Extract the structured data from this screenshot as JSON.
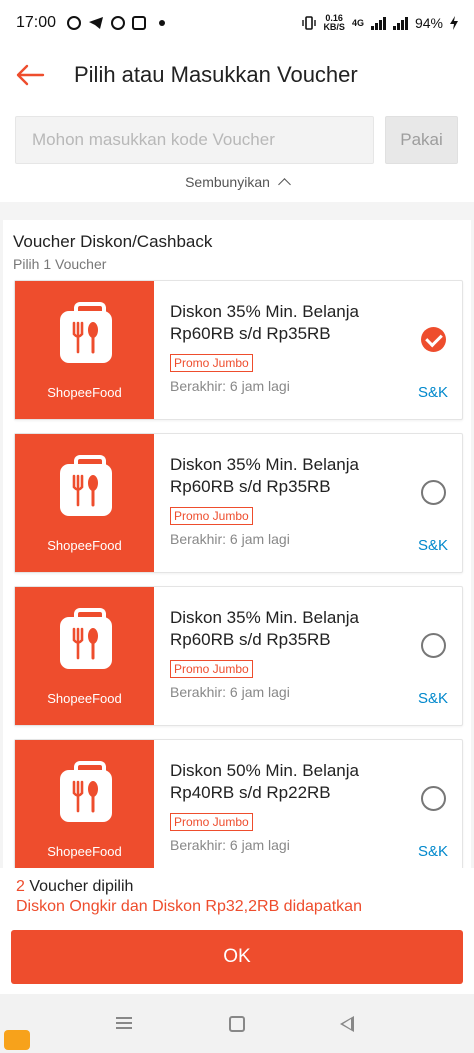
{
  "status_bar": {
    "time": "17:00",
    "net_speed_value": "0.16",
    "net_speed_unit": "KB/S",
    "network": "4G",
    "battery": "94%"
  },
  "header": {
    "title": "Pilih atau Masukkan Voucher"
  },
  "code_entry": {
    "placeholder": "Mohon masukkan kode Voucher",
    "apply_label": "Pakai"
  },
  "collapse": {
    "label": "Sembunyikan"
  },
  "section": {
    "title": "Voucher Diskon/Cashback",
    "subtitle": "Pilih 1 Voucher",
    "vouchers": [
      {
        "brand": "ShopeeFood",
        "title_line1": "Diskon 35% Min. Belanja",
        "title_line2": "Rp60RB s/d Rp35RB",
        "tag": "Promo Jumbo",
        "expiry": "Berakhir: 6 jam lagi",
        "terms": "S&K",
        "selected": true
      },
      {
        "brand": "ShopeeFood",
        "title_line1": "Diskon 35% Min. Belanja",
        "title_line2": "Rp60RB s/d Rp35RB",
        "tag": "Promo Jumbo",
        "expiry": "Berakhir: 6 jam lagi",
        "terms": "S&K",
        "selected": false
      },
      {
        "brand": "ShopeeFood",
        "title_line1": "Diskon 35% Min. Belanja",
        "title_line2": "Rp60RB s/d Rp35RB",
        "tag": "Promo Jumbo",
        "expiry": "Berakhir: 6 jam lagi",
        "terms": "S&K",
        "selected": false
      },
      {
        "brand": "ShopeeFood",
        "title_line1": "Diskon 50% Min. Belanja",
        "title_line2": "Rp40RB s/d Rp22RB",
        "tag": "Promo Jumbo",
        "expiry": "Berakhir: 6 jam lagi",
        "terms": "S&K",
        "selected": false
      }
    ]
  },
  "summary": {
    "count": "2",
    "count_label": " Voucher dipilih",
    "detail": "Diskon Ongkir dan Diskon Rp32,2RB didapatkan"
  },
  "ok_button": {
    "label": "OK"
  },
  "colors": {
    "accent": "#ee4d2d",
    "link": "#0088cc"
  },
  "icons": [
    "whatsapp-icon",
    "telegram-icon",
    "google-icon",
    "app-icon",
    "vibrate-icon",
    "signal-icon",
    "battery-icon",
    "back-arrow-icon",
    "chevron-up-icon",
    "shopeefood-bag-icon",
    "check-icon",
    "menu-nav-icon",
    "home-nav-icon",
    "back-nav-icon"
  ]
}
